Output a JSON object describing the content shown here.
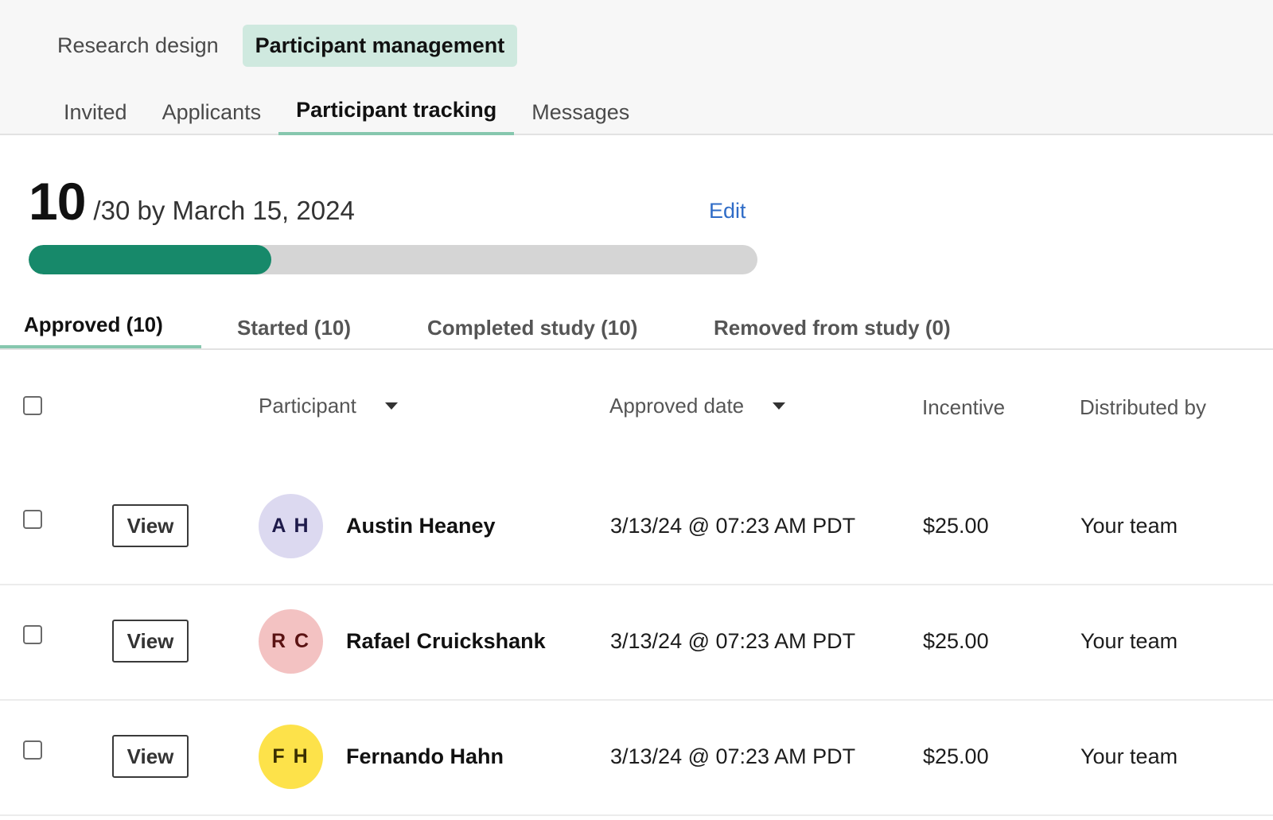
{
  "top_tabs": [
    {
      "label": "Research design",
      "active": false
    },
    {
      "label": "Participant management",
      "active": true
    }
  ],
  "sub_tabs": [
    {
      "label": "Invited",
      "active": false
    },
    {
      "label": "Applicants",
      "active": false
    },
    {
      "label": "Participant tracking",
      "active": true
    },
    {
      "label": "Messages",
      "active": false
    }
  ],
  "summary": {
    "count": "10",
    "target_text": "/30 by March 15, 2024",
    "edit_label": "Edit",
    "progress_fraction": 0.333,
    "progress_color": "#17896a"
  },
  "status_tabs": [
    {
      "label": "Approved (10)",
      "active": true
    },
    {
      "label": "Started (10)",
      "active": false
    },
    {
      "label": "Completed study (10)",
      "active": false
    },
    {
      "label": "Removed from study (0)",
      "active": false
    }
  ],
  "table": {
    "headers": {
      "participant": "Participant",
      "approved_date": "Approved date",
      "incentive": "Incentive",
      "distributed_by": "Distributed by"
    },
    "view_label": "View",
    "rows": [
      {
        "initials": "A H",
        "name": "Austin Heaney",
        "date": "3/13/24 @ 07:23 AM PDT",
        "incentive": "$25.00",
        "distributed_by": "Your team",
        "avatar_bg": "#dcd9f0",
        "avatar_fg": "#1e1a4a"
      },
      {
        "initials": "R C",
        "name": "Rafael Cruickshank",
        "date": "3/13/24 @ 07:23 AM PDT",
        "incentive": "$25.00",
        "distributed_by": "Your team",
        "avatar_bg": "#f3c2c2",
        "avatar_fg": "#5a1212"
      },
      {
        "initials": "F H",
        "name": "Fernando Hahn",
        "date": "3/13/24 @ 07:23 AM PDT",
        "incentive": "$25.00",
        "distributed_by": "Your team",
        "avatar_bg": "#fde24a",
        "avatar_fg": "#3a2e00"
      }
    ]
  }
}
